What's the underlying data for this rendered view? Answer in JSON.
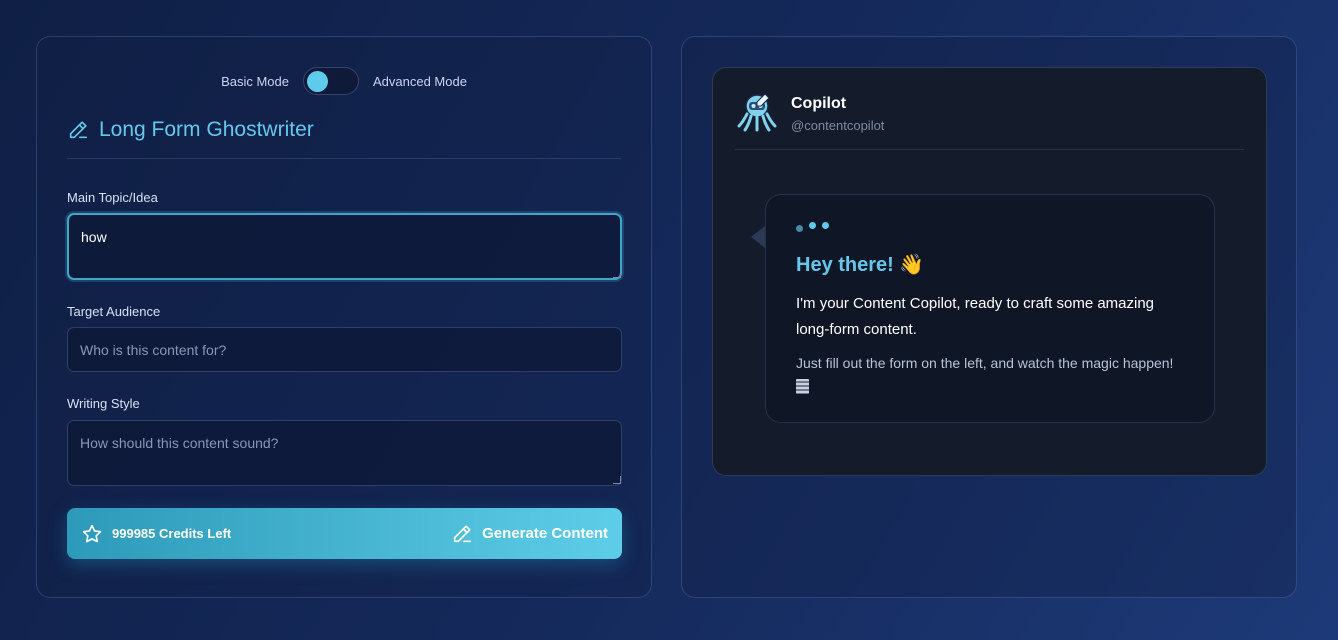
{
  "mode_toggle": {
    "basic_label": "Basic Mode",
    "advanced_label": "Advanced Mode",
    "selected": "Basic Mode"
  },
  "form": {
    "title": "Long Form Ghostwriter",
    "title_icon": "pencil-icon",
    "topic": {
      "label": "Main Topic/Idea",
      "value": "how",
      "placeholder": ""
    },
    "audience": {
      "label": "Target Audience",
      "value": "",
      "placeholder": "Who is this content for?"
    },
    "style": {
      "label": "Writing Style",
      "value": "",
      "placeholder": "How should this content sound?"
    },
    "credits_text": "999985 Credits Left",
    "credits_icon": "star-icon",
    "generate_label": "Generate Content",
    "generate_icon": "pencil-icon"
  },
  "chat": {
    "name": "Copilot",
    "handle": "@contentcopilot",
    "avatar_icon": "octopus-robot-avatar",
    "greeting": "Hey there! 👋",
    "message": "I'm your Content Copilot, ready to craft some amazing long-form content.",
    "subtext": "Just fill out the form on the left, and watch the magic happen!",
    "subtext_icon": "notepad-icon"
  },
  "colors": {
    "accent": "#64c8ec",
    "button_start": "#2c9ab8",
    "button_end": "#5ecde8",
    "card_bg": "#141c2c"
  }
}
